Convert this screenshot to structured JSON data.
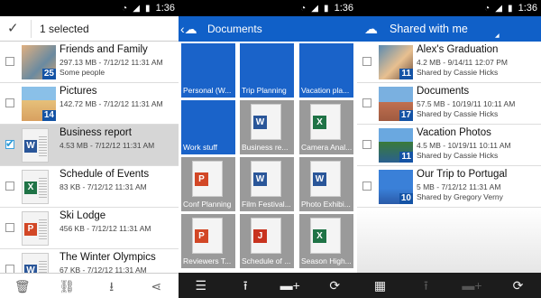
{
  "status": {
    "time": "1:36"
  },
  "panel1": {
    "title": "1 selected",
    "items": [
      {
        "name": "Friends and Family",
        "meta": "297.13 MB - 7/12/12 11:31 AM",
        "owner": "Some people",
        "count": "25"
      },
      {
        "name": "Pictures",
        "meta": "142.72 MB - 7/12/12 11:31 AM",
        "count": "14"
      },
      {
        "name": "Business report",
        "meta": "4.53 MB - 7/12/12 11:31 AM"
      },
      {
        "name": "Schedule of Events",
        "meta": "83 KB - 7/12/12 11:31 AM"
      },
      {
        "name": "Ski Lodge",
        "meta": "456 KB - 7/12/12 11:31 AM"
      },
      {
        "name": "The Winter Olympics",
        "meta": "67 KB - 7/12/12 11:31 AM"
      }
    ]
  },
  "panel2": {
    "title": "Documents",
    "tiles": [
      {
        "label": "Personal (W..."
      },
      {
        "label": "Trip Planning"
      },
      {
        "label": "Vacation pla..."
      },
      {
        "label": "Work stuff"
      },
      {
        "label": "Business re..."
      },
      {
        "label": "Camera Anal..."
      },
      {
        "label": "Conf Planning"
      },
      {
        "label": "Film Festival..."
      },
      {
        "label": "Photo Exhibi..."
      },
      {
        "label": "Reviewers T..."
      },
      {
        "label": "Schedule of ..."
      },
      {
        "label": "Season High..."
      }
    ]
  },
  "panel3": {
    "title": "Shared with me",
    "items": [
      {
        "name": "Alex's Graduation",
        "meta": "4.2 MB - 9/14/11 12:07 PM",
        "owner": "Shared by Cassie Hicks",
        "count": "11"
      },
      {
        "name": "Documents",
        "meta": "57.5 MB - 10/19/11 10:11 AM",
        "owner": "Shared by Cassie Hicks",
        "count": "17"
      },
      {
        "name": "Vacation Photos",
        "meta": "4.5 MB - 10/19/11 10:11 AM",
        "owner": "Shared by Cassie Hicks",
        "count": "11"
      },
      {
        "name": "Our Trip to Portugal",
        "meta": "5 MB - 7/12/12 11:31 AM",
        "owner": "Shared by Gregory Verny",
        "count": "10"
      }
    ]
  },
  "icons": {
    "word": "W",
    "excel": "X",
    "ppt": "P",
    "pdf": "J"
  },
  "colors": {
    "accent": "#1a63c9",
    "blue_bar": "#1060c8",
    "dark": "#1c1c1c"
  }
}
